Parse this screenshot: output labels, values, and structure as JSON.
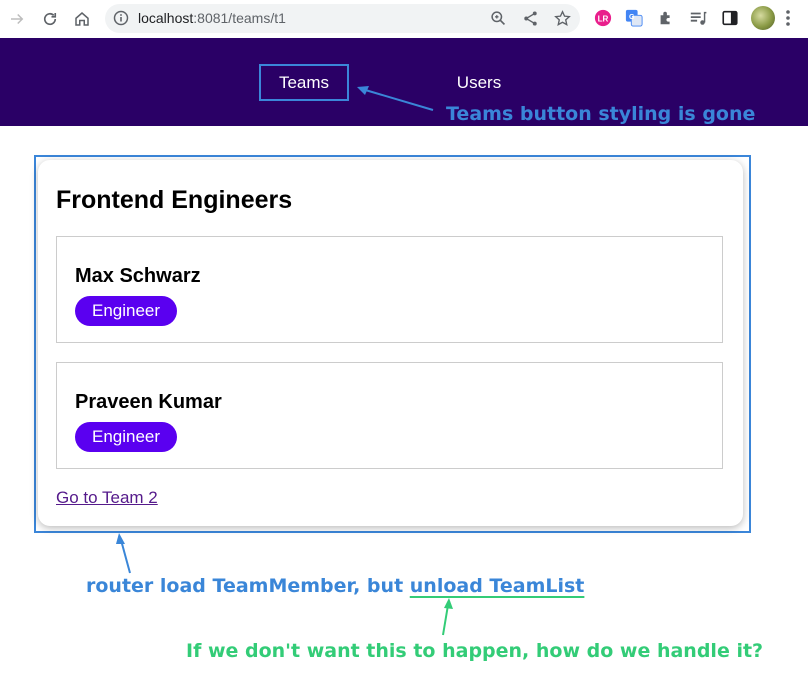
{
  "browser": {
    "url_host": "localhost",
    "url_rest": ":8081/teams/t1"
  },
  "header": {
    "nav": [
      {
        "label": "Teams"
      },
      {
        "label": "Users"
      }
    ]
  },
  "team": {
    "title": "Frontend Engineers",
    "members": [
      {
        "name": "Max Schwarz",
        "role": "Engineer"
      },
      {
        "name": "Praveen Kumar",
        "role": "Engineer"
      }
    ],
    "link_label": "Go to Team 2"
  },
  "annotations": {
    "teams_button": "Teams button styling is gone",
    "router_prefix": "router load TeamMember, but ",
    "router_highlight": "unload TeamList",
    "question": "If we don't want this to happen, how do we handle it?"
  },
  "colors": {
    "header_bg": "#2a0066",
    "badge_bg": "#5a00f0",
    "annotation_blue": "#3a86d8",
    "annotation_green": "#33cc77"
  }
}
